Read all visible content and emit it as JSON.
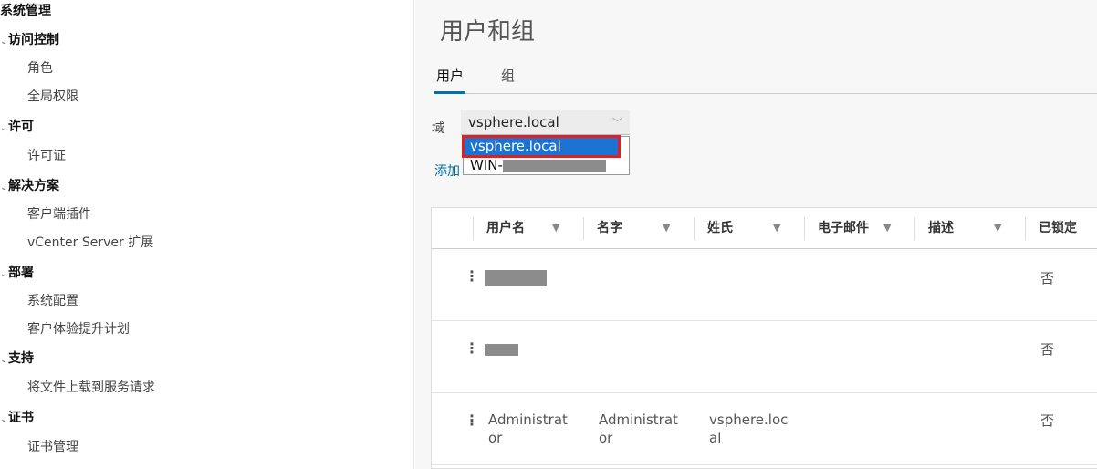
{
  "sidebar": {
    "root": "系统管理",
    "sections": [
      {
        "label": "访问控制",
        "items": [
          "角色",
          "全局权限"
        ]
      },
      {
        "label": "许可",
        "items": [
          "许可证"
        ]
      },
      {
        "label": "解决方案",
        "items": [
          "客户端插件",
          "vCenter Server 扩展"
        ]
      },
      {
        "label": "部署",
        "items": [
          "系统配置",
          "客户体验提升计划"
        ]
      },
      {
        "label": "支持",
        "items": [
          "将文件上载到服务请求"
        ]
      },
      {
        "label": "证书",
        "items": [
          "证书管理"
        ]
      }
    ]
  },
  "main": {
    "title": "用户和组",
    "tabs": [
      "用户",
      "组"
    ],
    "active_tab": "用户",
    "domain_label": "域",
    "domain_value": "vsphere.local",
    "domain_options": [
      "vsphere.local",
      "WIN-"
    ],
    "add_label": "添加",
    "table": {
      "columns": [
        "用户名",
        "名字",
        "姓氏",
        "电子邮件",
        "描述",
        "已锁定"
      ],
      "rows": [
        {
          "username": "",
          "first": "",
          "last": "",
          "email": "",
          "desc": "",
          "locked": "否"
        },
        {
          "username": "",
          "first": "",
          "last": "",
          "email": "",
          "desc": "",
          "locked": "否"
        },
        {
          "username": "Administrator",
          "first": "Administrator",
          "last": "vsphere.local",
          "email": "",
          "desc": "",
          "locked": "否"
        }
      ]
    }
  },
  "colors": {
    "accent": "#0072a3",
    "selection": "#1c73d2",
    "highlight_box": "#e02020"
  },
  "icons": {
    "filter": "filter-icon",
    "row_menu": "kebab-menu-icon",
    "collapse": "chevron-down-icon",
    "select_caret": "chevron-down-icon"
  }
}
